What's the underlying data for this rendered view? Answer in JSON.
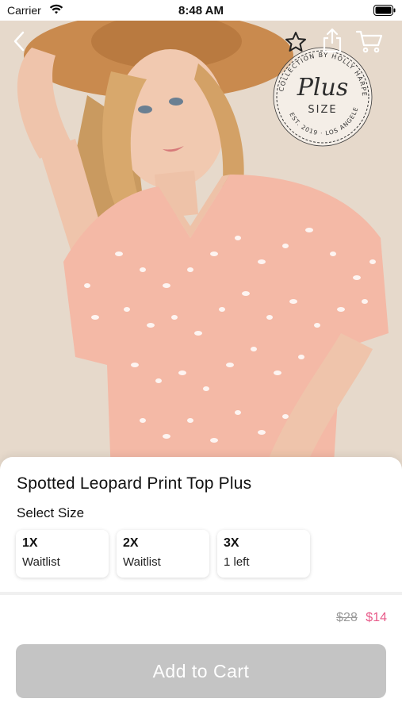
{
  "status_bar": {
    "carrier": "Carrier",
    "time": "8:48 AM"
  },
  "nav": {
    "icons": [
      "chevron-left-icon",
      "star-icon",
      "share-icon",
      "cart-icon"
    ]
  },
  "brand_stamp": {
    "script_text": "Plus",
    "sub_text": "SIZE",
    "ring_text": "COLLECTION BY HOLLY HARPER",
    "est_text": "EST. 2019 · LOS ANGELES"
  },
  "product": {
    "title": "Spotted Leopard Print Top Plus",
    "select_size_label": "Select Size",
    "sizes": [
      {
        "name": "1X",
        "status": "Waitlist"
      },
      {
        "name": "2X",
        "status": "Waitlist"
      },
      {
        "name": "3X",
        "status": "1 left"
      }
    ],
    "price_original": "$28",
    "price_sale": "$14"
  },
  "actions": {
    "add_to_cart_label": "Add to Cart"
  },
  "colors": {
    "sale_price": "#e85b8a",
    "button_disabled": "#c4c4c4",
    "top_fabric": "#f4b9a6"
  }
}
